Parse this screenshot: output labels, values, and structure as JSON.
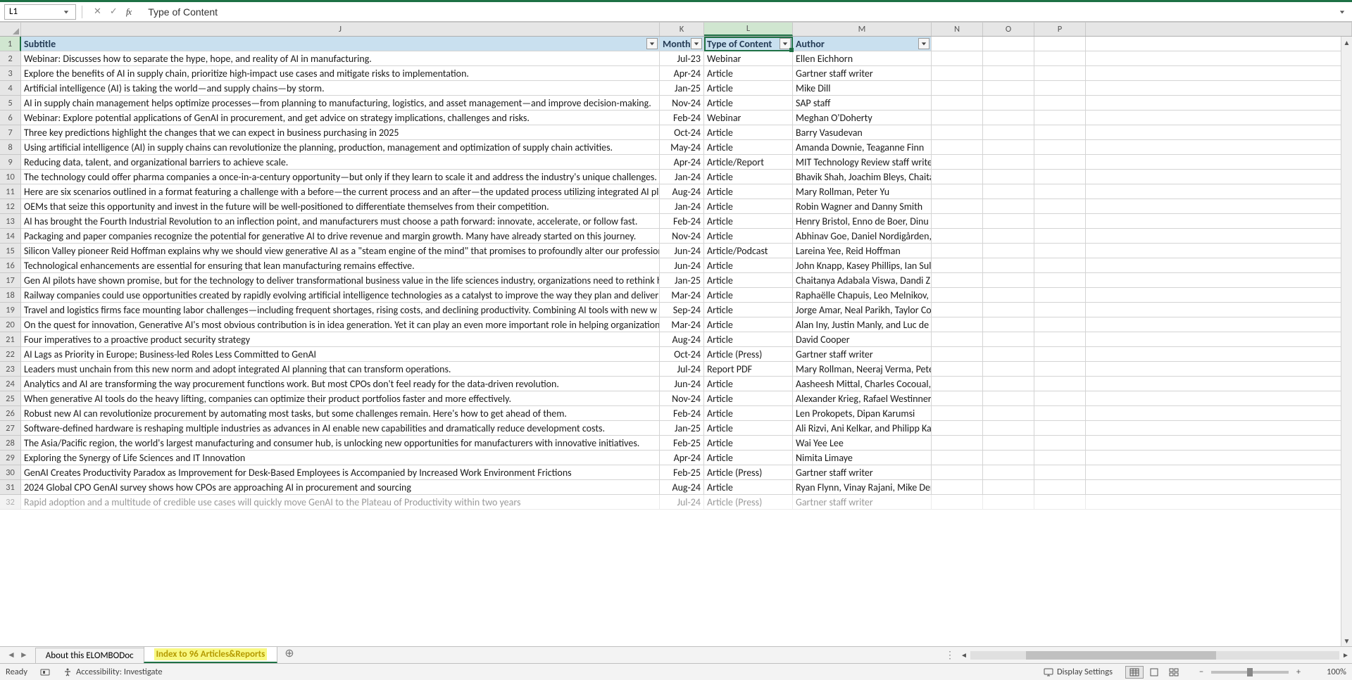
{
  "name_box": "L1",
  "formula_value": "Type of Content",
  "columns": [
    "J",
    "K",
    "L",
    "M",
    "N",
    "O",
    "P"
  ],
  "active_column": "L",
  "header_row": {
    "J": "Subtitle",
    "K": "Month Published",
    "L": "Type of Content",
    "M": "Author"
  },
  "rows": [
    {
      "n": 2,
      "j": "Webinar: Discusses how to separate the hype, hope, and reality of AI in manufacturing.",
      "k": "Jul-23",
      "l": "Webinar",
      "m": "Ellen Eichhorn"
    },
    {
      "n": 3,
      "j": "Explore the benefits of AI in supply chain, prioritize high-impact use cases and mitigate risks to implementation.",
      "k": "Apr-24",
      "l": "Article",
      "m": "Gartner staff writer"
    },
    {
      "n": 4,
      "j": "Artificial intelligence (AI) is taking the world—and supply chains—by storm.",
      "k": "Jan-25",
      "l": "Article",
      "m": "Mike Dill"
    },
    {
      "n": 5,
      "j": "AI in supply chain management helps optimize processes—from planning to manufacturing, logistics, and asset management—and improve decision-making.",
      "k": "Nov-24",
      "l": "Article",
      "m": "SAP staff"
    },
    {
      "n": 6,
      "j": "Webinar: Explore potential applications of GenAI in procurement, and get advice on strategy implications, challenges and risks.",
      "k": "Feb-24",
      "l": "Webinar",
      "m": "Meghan O'Doherty"
    },
    {
      "n": 7,
      "j": "Three key predictions highlight the changes that we can expect in business purchasing in 2025",
      "k": "Oct-24",
      "l": "Article",
      "m": "Barry Vasudevan"
    },
    {
      "n": 8,
      "j": "Using artificial intelligence (AI) in supply chains can revolutionize the planning, production, management and optimization of supply chain activities.",
      "k": "May-24",
      "l": "Article",
      "m": "Amanda Downie, Teaganne Finn"
    },
    {
      "n": 9,
      "j": "Reducing data, talent, and organizational barriers to achieve scale.",
      "k": "Apr-24",
      "l": "Article/Report",
      "m": "MIT Technology Review staff writer"
    },
    {
      "n": 10,
      "j": "The technology could offer pharma companies a once-in-a-century opportunity—but only if they learn to scale it and address the industry's unique challenges.",
      "k": "Jan-24",
      "l": "Article",
      "m": "Bhavik Shah, Joachim Bleys, Chaitanya Adabala Viswa, Delphine Zurkiya"
    },
    {
      "n": 11,
      "j": "Here are six scenarios outlined in a format featuring a challenge with a before—the current process and an after—the updated process utilizing integrated AI pl",
      "k": "Aug-24",
      "l": "Article",
      "m": "Mary Rollman, Peter Yu"
    },
    {
      "n": 12,
      "j": "OEMs that seize this opportunity and invest in the future will be well-positioned to differentiate themselves from their competition.",
      "k": "Jan-24",
      "l": "Article",
      "m": "Robin Wagner and Danny Smith"
    },
    {
      "n": 13,
      "j": "AI has brought the Fourth Industrial Revolution to an inflection point, and manufacturers must choose a path forward: innovate, accelerate, or follow fast.",
      "k": "Feb-24",
      "l": "Article",
      "m": "Henry Bristol, Enno de Boer, Dinu de Kroon, Rahul Shahani, and Federic"
    },
    {
      "n": 14,
      "j": "Packaging and paper companies recognize the potential for generative AI to drive revenue and margin growth. Many have already started on this journey.",
      "k": "Nov-24",
      "l": "Article",
      "m": "Abhinav Goe, Daniel Nordigården, David Feber, Yashaswi Gautam, and"
    },
    {
      "n": 15,
      "j": "Silicon Valley pioneer Reid Hoffman explains why we should view generative AI as a \"steam engine of the mind\" that promises to profoundly alter our profession",
      "k": "Jun-24",
      "l": "Article/Podcast",
      "m": "Lareina Yee, Reid Hoffman"
    },
    {
      "n": 16,
      "j": "Technological enhancements are essential for ensuring that lean manufacturing remains effective.",
      "k": "Jun-24",
      "l": "Article",
      "m": "John Knapp, Kasey Phillips, Ian Sullivan, Alex Yurek, Denis Doerbandt, K"
    },
    {
      "n": 17,
      "j": "Gen AI pilots have shown promise, but for the technology to deliver transformational business value in the life sciences industry, organizations need to rethink h",
      "k": "Jan-25",
      "l": "Article",
      "m": "Chaitanya Adabala Viswa, Dandi Zhu, Delphine Zurkiya, and Joachim Bl"
    },
    {
      "n": 18,
      "j": "Railway companies could use opportunities created by rapidly evolving artificial intelligence technologies as a catalyst to improve the way they plan and deliver",
      "k": "Mar-24",
      "l": "Article",
      "m": "Raphaëlle Chapuis, Leo Melnikov, and  Nicola Sandri"
    },
    {
      "n": 19,
      "j": "Travel and logistics firms face mounting labor challenges—including frequent shortages, rising costs, and declining productivity. Combining AI tools with new w",
      "k": "Sep-24",
      "l": "Article",
      "m": "Jorge Amar, Neal Parikh, Taylor Cornwall, Sal Arora, Scott McConnell, a"
    },
    {
      "n": 20,
      "j": "On the quest for innovation, Generative AI's most obvious contribution is in idea generation. Yet it can play an even more important role in helping organizations",
      "k": "Mar-24",
      "l": "Article",
      "m": "Alan Iny,  Justin Manly, and  Luc de Brabandere"
    },
    {
      "n": 21,
      "j": "Four imperatives to a proactive product security strategy",
      "k": "Aug-24",
      "l": "Article",
      "m": "David Cooper"
    },
    {
      "n": 22,
      "j": "AI Lags as Priority in Europe; Business-led Roles Less Committed to GenAI",
      "k": "Oct-24",
      "l": "Article (Press)",
      "m": "Gartner staff writer"
    },
    {
      "n": 23,
      "j": "Leaders must unchain from this new norm and adopt integrated AI planning that can transform operations.",
      "k": "Jul-24",
      "l": "Report PDF",
      "m": "Mary Rollman, Neeraj Verma, Peter Yu"
    },
    {
      "n": 24,
      "j": "Analytics and AI are transforming the way procurement functions work. But most CPOs don't feel ready for the data-driven revolution.",
      "k": "Jun-24",
      "l": "Article",
      "m": "Aasheesh Mittal, Charles Cocoual, Mauro Errique, and Theano Liakopo"
    },
    {
      "n": 25,
      "j": "When generative AI tools do the heavy lifting, companies can optimize their product portfolios faster and more effectively.",
      "k": "Nov-24",
      "l": "Article",
      "m": "Alexander Krieg, Rafael Westinner, Dominic Distel, and Lars Schönenb"
    },
    {
      "n": 26,
      "j": "Robust new AI can revolutionize procurement by automating most tasks, but some challenges remain. Here's how to get ahead of them.",
      "k": "Feb-24",
      "l": "Article",
      "m": "Len Prokopets, Dipan Karumsi"
    },
    {
      "n": 27,
      "j": "Software-defined hardware is reshaping multiple industries as advances in AI enable new capabilities and dramatically reduce development costs.",
      "k": "Jan-25",
      "l": "Article",
      "m": "Ali Rizvi, Ani Kelkar, and Philipp Kampshoff, and Sarthak Vaish"
    },
    {
      "n": 28,
      "j": "The Asia/Pacific region, the world's largest manufacturing and consumer hub, is unlocking new opportunities for manufacturers with innovative initiatives.",
      "k": "Feb-25",
      "l": "Article",
      "m": "Wai Yee Lee"
    },
    {
      "n": 29,
      "j": "Exploring the Synergy of Life Sciences and IT Innovation",
      "k": "Apr-24",
      "l": "Article",
      "m": "Nimita Limaye"
    },
    {
      "n": 30,
      "j": "GenAI Creates Productivity Paradox as Improvement for Desk-Based Employees is Accompanied by Increased Work Environment Frictions",
      "k": "Feb-25",
      "l": "Article (Press)",
      "m": "Gartner staff writer"
    },
    {
      "n": 31,
      "j": "2024 Global CPO GenAI survey shows how CPOs are approaching AI in procurement and sourcing",
      "k": "Aug-24",
      "l": "Article",
      "m": "Ryan Flynn, Vinay Rajani, Mike Deng, Ayushman Kaul"
    },
    {
      "n": 32,
      "j": "Rapid adoption and a multitude of credible use cases will quickly move GenAI to the Plateau of Productivity within two years",
      "k": "Jul-24",
      "l": "Article (Press)",
      "m": "Gartner staff writer"
    }
  ],
  "tabs": [
    {
      "label": "About this ELOMBODoc",
      "active": false
    },
    {
      "label": "Index to 96 Articles&Reports",
      "active": true
    }
  ],
  "status": {
    "ready": "Ready",
    "accessibility": "Accessibility: Investigate",
    "display_settings": "Display Settings",
    "zoom": "100%"
  }
}
